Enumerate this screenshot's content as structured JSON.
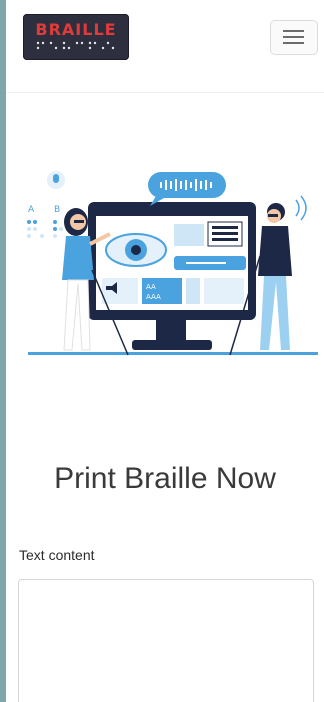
{
  "brand": {
    "logo_text": "BRAILLE"
  },
  "hero": {
    "heading": "Print Braille Now"
  },
  "form": {
    "text_label": "Text content",
    "text_value": ""
  },
  "colors": {
    "page_bg": "#ffffff",
    "logo_bg": "#2d2f3e",
    "logo_accent": "#e03a3a",
    "side_bg": "#7fa6a8"
  },
  "icons": {
    "menu": "hamburger-menu-icon"
  }
}
